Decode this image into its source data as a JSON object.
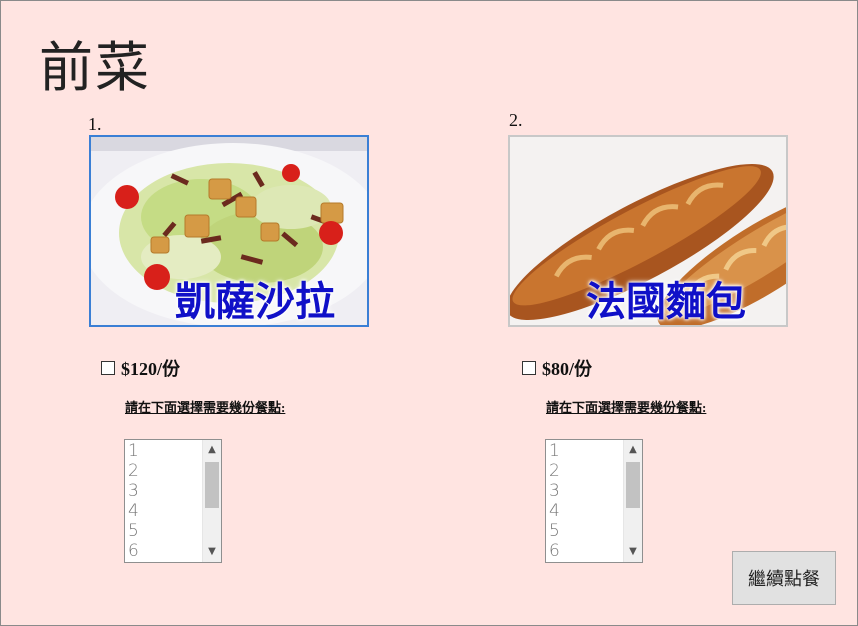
{
  "page": {
    "title": "前菜"
  },
  "items": [
    {
      "number": "1.",
      "caption": "凱薩沙拉",
      "price": "$120/份",
      "hint": "請在下面選擇需要幾份餐點:",
      "options": [
        "1",
        "2",
        "3",
        "4",
        "5",
        "6"
      ]
    },
    {
      "number": "2.",
      "caption": "法國麵包",
      "price": "$80/份",
      "hint": "請在下面選擇需要幾份餐點:",
      "options": [
        "1",
        "2",
        "3",
        "4",
        "5",
        "6"
      ]
    }
  ],
  "actions": {
    "continue_label": "繼續點餐"
  },
  "colors": {
    "background": "#ffe4e1",
    "caption": "#1010c8",
    "selected_border": "#3a7fd5"
  }
}
